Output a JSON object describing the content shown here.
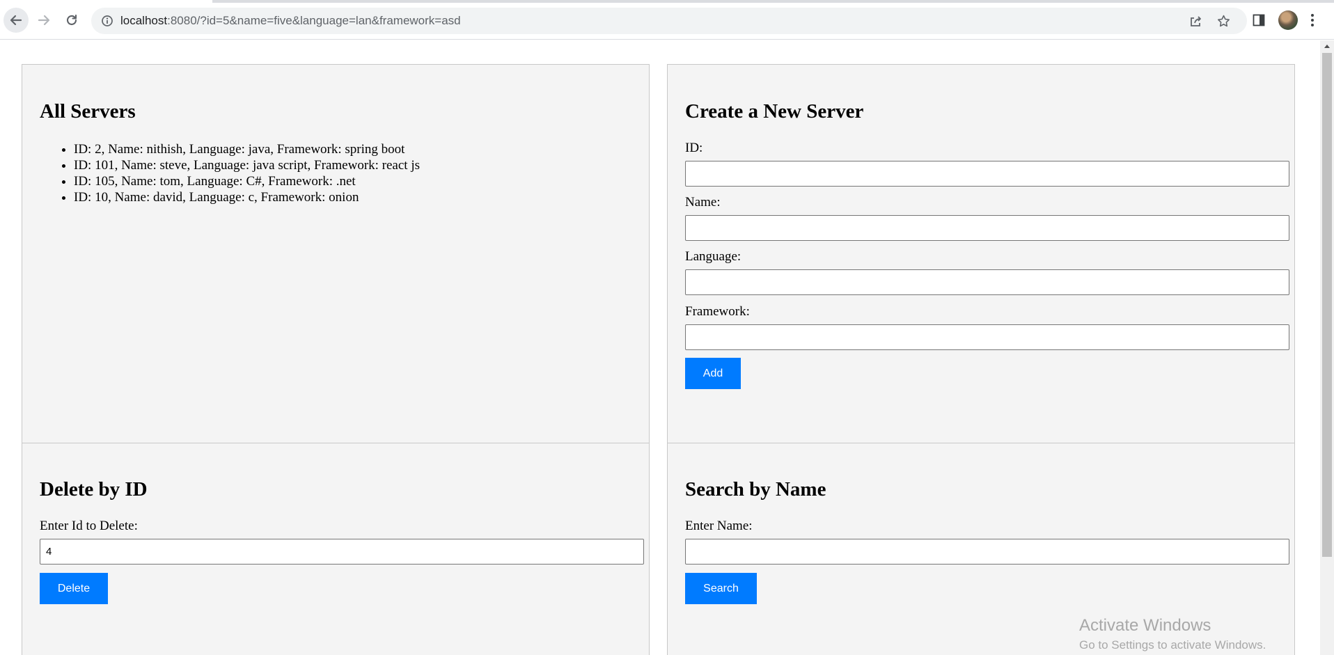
{
  "browser": {
    "url_host": "localhost",
    "url_rest": ":8080/?id=5&name=five&language=lan&framework=asd",
    "icons": {
      "back": "back-arrow-icon",
      "forward": "forward-arrow-icon",
      "reload": "reload-icon",
      "info": "info-icon",
      "share": "share-icon",
      "bookmark": "star-icon",
      "side_panel": "side-panel-icon",
      "menu": "kebab-menu-icon"
    }
  },
  "all_servers": {
    "title": "All Servers",
    "items": [
      "ID: 2, Name: nithish, Language: java, Framework: spring boot",
      "ID: 101, Name: steve, Language: java script, Framework: react js",
      "ID: 105, Name: tom, Language: C#, Framework: .net",
      "ID: 10, Name: david, Language: c, Framework: onion"
    ]
  },
  "create": {
    "title": "Create a New Server",
    "id_label": "ID:",
    "id_value": "",
    "name_label": "Name:",
    "name_value": "",
    "language_label": "Language:",
    "language_value": "",
    "framework_label": "Framework:",
    "framework_value": "",
    "add_label": "Add"
  },
  "delete": {
    "title": "Delete by ID",
    "id_label": "Enter Id to Delete:",
    "id_value": "4",
    "button_label": "Delete"
  },
  "search": {
    "title": "Search by Name",
    "name_label": "Enter Name:",
    "name_value": "",
    "button_label": "Search"
  },
  "watermark": {
    "line1": "Activate Windows",
    "line2": "Go to Settings to activate Windows."
  },
  "colors": {
    "button": "#007bff",
    "panel": "#f4f4f4",
    "panel_border": "#c8c8c8"
  }
}
